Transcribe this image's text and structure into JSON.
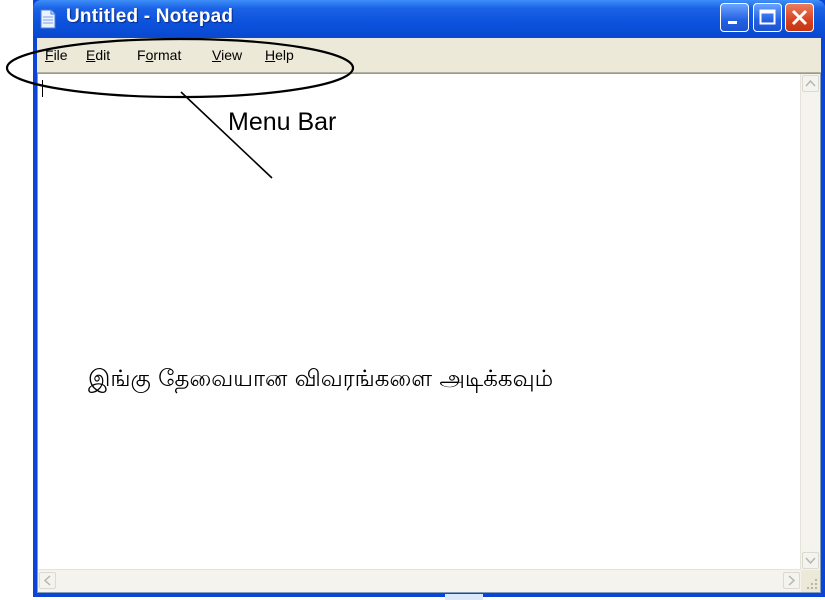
{
  "window": {
    "title": "Untitled - Notepad",
    "icons": {
      "app": "notepad-icon",
      "minimize": "minimize-icon",
      "maximize": "maximize-icon",
      "close": "close-icon"
    }
  },
  "menubar": {
    "items": [
      {
        "label": "File",
        "accel": "F",
        "rest": "ile"
      },
      {
        "label": "Edit",
        "accel": "E",
        "rest": "dit"
      },
      {
        "label": "Format",
        "accel": "o",
        "pre": "F",
        "rest": "rmat"
      },
      {
        "label": "View",
        "accel": "V",
        "rest": "iew"
      },
      {
        "label": "Help",
        "accel": "H",
        "rest": "elp"
      }
    ]
  },
  "editor": {
    "body_text": "இங்கு தேவையான விவரங்களை அடிக்கவும்"
  },
  "annotation": {
    "label": "Menu Bar"
  },
  "colors": {
    "titlebar": "#0a45d8",
    "menubar": "#ece9d8",
    "close_button": "#d8421e"
  }
}
